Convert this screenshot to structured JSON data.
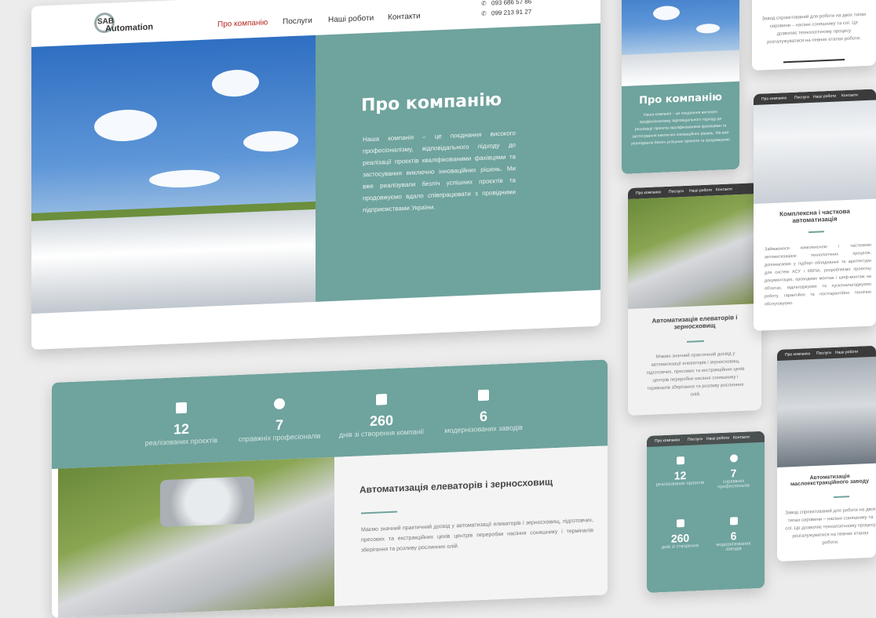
{
  "site": {
    "logo_line1": "SAB",
    "logo_line2": "Automation",
    "nav": [
      "Про компанію",
      "Послуги",
      "Наші роботи",
      "Контакти"
    ],
    "phones": [
      "093 686 57 86",
      "099 213 91 27"
    ]
  },
  "about": {
    "title": "Про компанію",
    "text": "Наша компанія – це поєднання високого професіоналізму, відповідального підходу до реалізації проєктів кваліфікованими фахівцями та застосування виключно інноваційних рішень. Ми вже реалізували безліч успішних проєктів та продовжуємо вдало співпрацювати з провідними підприємствами України."
  },
  "stats": [
    {
      "icon": "briefcase-icon",
      "value": "12",
      "label": "реалізованих проєктів"
    },
    {
      "icon": "user-icon",
      "value": "7",
      "label": "справжніх професіоналів"
    },
    {
      "icon": "flag-icon",
      "value": "260",
      "label": "днів зі створення компанії"
    },
    {
      "icon": "coffee-icon",
      "value": "6",
      "label": "модернізованих заводів"
    }
  ],
  "elevators": {
    "title": "Автоматизація елеваторів і зерносховищ",
    "text": "Маємо значний практичний досвід у автоматизації елеваторів і зерносховищ, підготовчих, пресових та екстракційних цехів центрів переробки насіння соняшнику і терміналів зберігання та розливу рослинних олій."
  },
  "mobile": {
    "about_title": "Про компанію",
    "about_text": "Наша компанія – це поєднання високого професіоналізму, відповідального підходу до реалізації проєктів кваліфікованими фахівцями та застосування виключно інноваційних рішень. Ми вже реалізували безліч успішних проєктів та продовжуємо",
    "elev_title": "Автоматизація елеваторів і зерносховищ",
    "elev_text": "Маємо значний практичний досвід у автоматизації елеваторів і зерносховищ, підготовчих, пресових та екстракційних цехів центрів переробки насіння соняшнику і терміналів зберігання та розливу рослинних олій.",
    "complex_title": "Комплексна і часткова автоматизація",
    "complex_text": "Займаємося комплексною і частковою автоматизацією технологічних процесів, допомагаємо у підборі обладнання та архітектури для систем АСУ і КВПіА, розробляємо проєктну документацію, проводимо монтаж і шеф-монтаж на об'єктах, відлагоджуємо та пусконалагоджуємо роботу, гарантійно та постгарантійно технічно обслуговуємо.",
    "oil_title": "Автоматизація маслоекстракційного заводу",
    "oil_text": "Завод спроєктований для роботи на двох типах сировини – насінні соняшнику та сої. Це дозволяє технологічному процесу розгалужуватися на певних етапах роботи.",
    "top_text": "Завод спроєктований для роботи на двох типах сировини – насінні соняшнику та сої. Це дозволяє технологічному процесу розгалужуватися на певних етапах роботи.",
    "stats_compact": [
      {
        "value": "12",
        "label": "реалізованих проєктів"
      },
      {
        "value": "7",
        "label": "справжніх професіоналів"
      },
      {
        "value": "260",
        "label": "днів зі створення"
      },
      {
        "value": "6",
        "label": "модернізованих заводів"
      }
    ]
  }
}
